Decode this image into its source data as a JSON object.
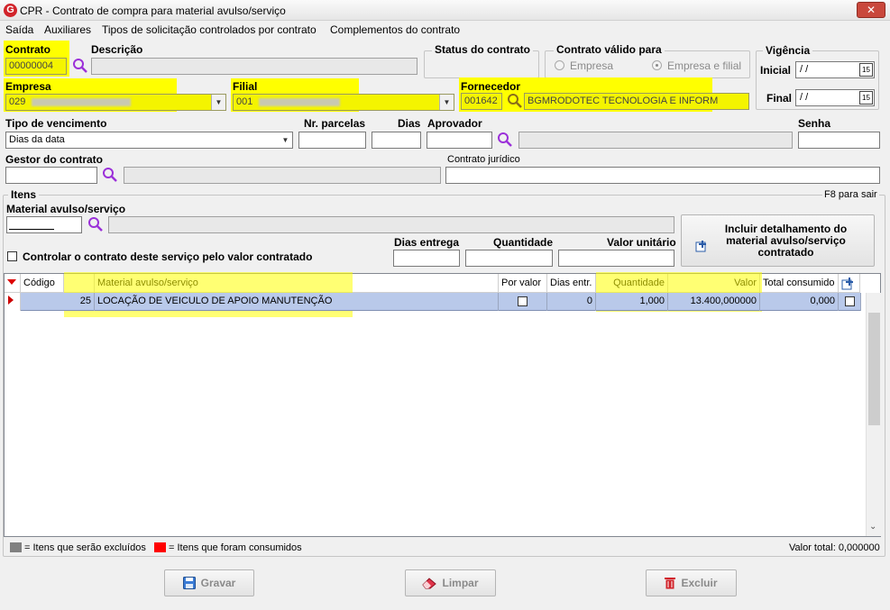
{
  "window": {
    "title": "CPR - Contrato de compra para material avulso/serviço",
    "close": "✕",
    "app_letter": "G"
  },
  "menu": [
    "Saída",
    "Auxiliares",
    "Tipos de solicitação controlados por contrato",
    "Complementos do contrato"
  ],
  "header": {
    "contrato_label": "Contrato",
    "contrato_value": "00000004",
    "descricao_label": "Descrição",
    "descricao_value": "",
    "status_label": "Status do contrato",
    "valido_label": "Contrato válido para",
    "valido_opt1": "Empresa",
    "valido_opt2": "Empresa e filial",
    "valido_selected": "Empresa e filial",
    "vigencia_label": "Vigência",
    "inicial_label": "Inicial",
    "inicial_value": " / /",
    "final_label": "Final",
    "final_value": " / /",
    "empresa_label": "Empresa",
    "empresa_value": "029",
    "filial_label": "Filial",
    "filial_value": "001",
    "fornecedor_label": "Fornecedor",
    "fornecedor_code": "001642",
    "fornecedor_name": "BGMRODOTEC TECNOLOGIA E INFORM",
    "tipo_venc_label": "Tipo de vencimento",
    "tipo_venc_value": "Dias da data",
    "parcelas_label": "Nr. parcelas",
    "parcelas_value": "",
    "dias_label": "Dias",
    "dias_value": "",
    "aprovador_label": "Aprovador",
    "aprovador_value": "",
    "senha_label": "Senha",
    "senha_value": "",
    "gestor_label": "Gestor do contrato",
    "gestor_value": "",
    "juridico_label": "Contrato jurídico",
    "juridico_value": ""
  },
  "itens": {
    "label": "Itens",
    "f8_hint": "F8 para sair",
    "material_label": "Material avulso/serviço",
    "material_value": "",
    "controlar_label": "Controlar o contrato deste serviço pelo valor contratado",
    "dias_entrega_label": "Dias entrega",
    "quantidade_label": "Quantidade",
    "valor_unit_label": "Valor unitário",
    "incluir_button": "Incluir detalhamento do material avulso/serviço contratado"
  },
  "grid": {
    "columns": [
      "Código",
      "Material avulso/serviço",
      "Por valor",
      "Dias entr.",
      "Quantidade",
      "Valor",
      "Total consumido"
    ],
    "rows": [
      {
        "codigo": "25",
        "material": "LOCAÇÃO DE VEICULO DE APOIO MANUTENÇÃO",
        "por_valor": false,
        "dias_entr": "0",
        "quantidade": "1,000",
        "valor": "13.400,000000",
        "total_consumido": "0,000"
      }
    ]
  },
  "footer": {
    "legend_excluded": "= Itens que serão excluídos",
    "legend_consumed": "= Itens que foram consumidos",
    "valor_total": "Valor total: 0,000000"
  },
  "buttons": {
    "gravar": "Gravar",
    "limpar": "Limpar",
    "excluir": "Excluir"
  },
  "colors": {
    "highlight": "#ffff00",
    "row_selected": "#b9c9ea",
    "legend_gray": "#808080",
    "legend_red": "#ff0000",
    "accent": "#d1232a"
  }
}
